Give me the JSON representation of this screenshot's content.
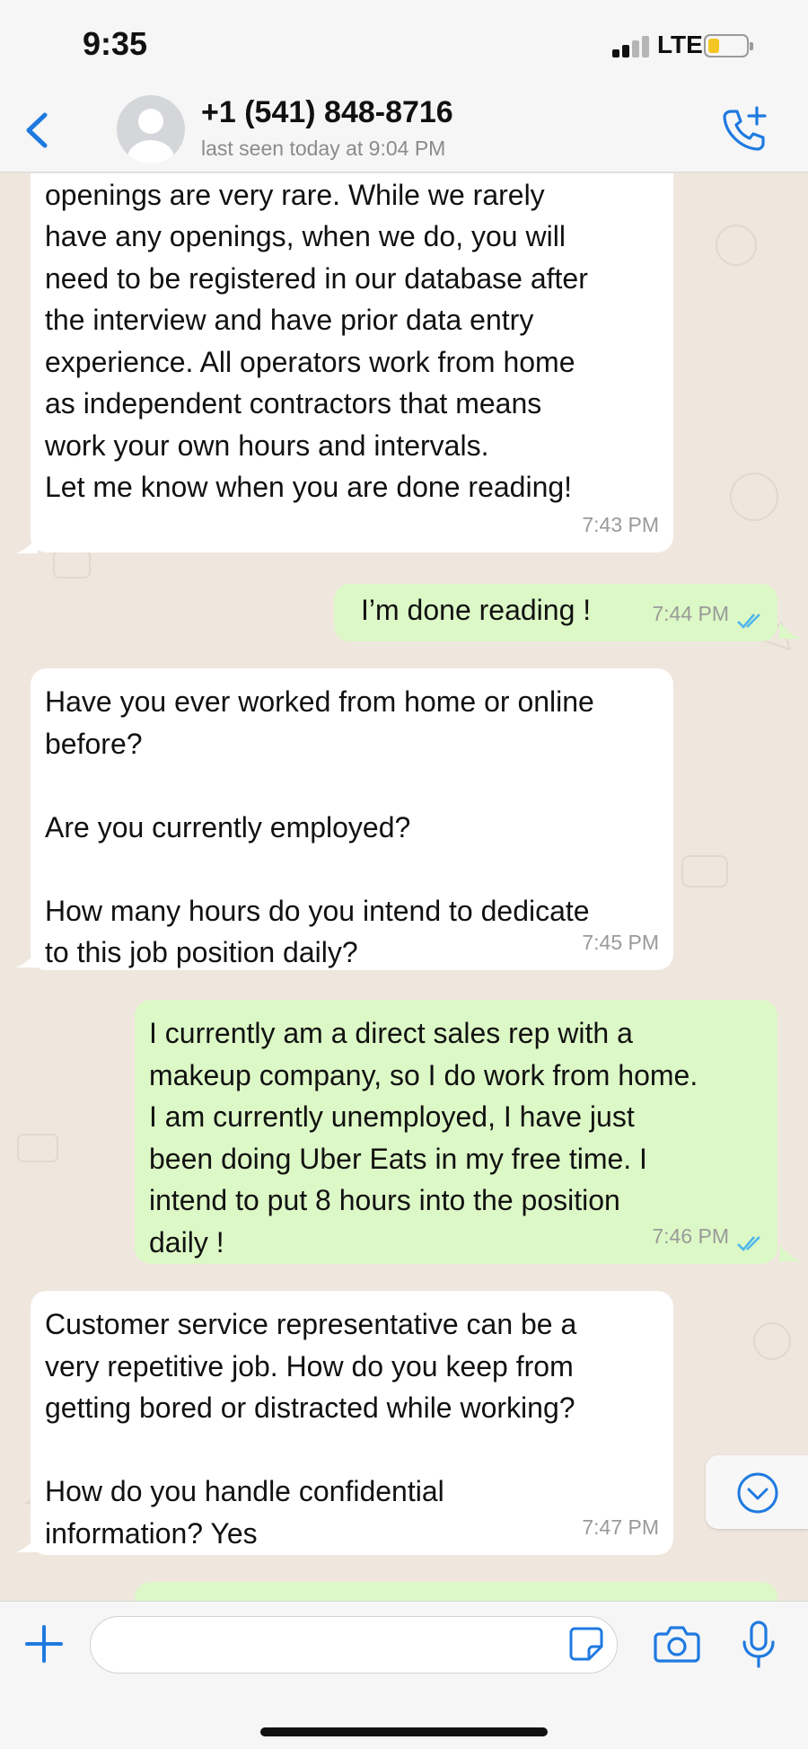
{
  "status_bar": {
    "time": "9:35",
    "network": "LTE"
  },
  "header": {
    "contact_name": "+1 (541) 848-8716",
    "contact_status": "last seen today at 9:04 PM"
  },
  "messages": [
    {
      "direction": "in",
      "text": "openings are very rare. While we rarely\nhave any openings, when we do, you will\nneed to be registered in our database after\nthe interview and have prior data entry\nexperience. All operators work from home\nas independent contractors that means\nwork your own hours and intervals.\nLet me know when you are done reading!",
      "time": "7:43 PM"
    },
    {
      "direction": "out",
      "text": "I’m done reading !",
      "time": "7:44 PM"
    },
    {
      "direction": "in",
      "text": "Have you ever worked from home or online\nbefore?\n\nAre you currently employed?\n\nHow many hours do you intend to dedicate\nto this job position daily?",
      "time": "7:45 PM"
    },
    {
      "direction": "out",
      "text": "I currently am a direct sales rep with a\nmakeup company, so I do work from home.\nI am currently unemployed, I have just\nbeen doing Uber Eats in my free time. I\nintend to put 8 hours into the position\ndaily !",
      "time": "7:46 PM"
    },
    {
      "direction": "in",
      "text": "Customer service representative can be a\nvery repetitive job. How do you keep from\ngetting bored or distracted while working?\n\nHow do you handle confidential\ninformation? Yes",
      "time": "7:47 PM"
    }
  ],
  "input": {
    "placeholder": ""
  },
  "colors": {
    "accent": "#1f7ae0",
    "incoming_bubble": "#ffffff",
    "outgoing_bubble": "#dcf8c6",
    "read_ticks": "#4fb6ec",
    "chat_background": "#efe7de"
  },
  "icons": [
    "back-icon",
    "avatar",
    "call-add-icon",
    "double-check-icon",
    "scroll-down-icon",
    "plus-icon",
    "sticker-icon",
    "camera-icon",
    "microphone-icon"
  ]
}
